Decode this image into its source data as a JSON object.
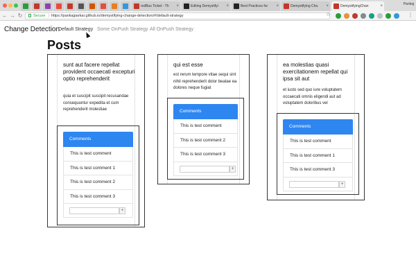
{
  "browser": {
    "tabs": [
      {
        "label": "",
        "favicon": "#2a9d3b"
      },
      {
        "label": "",
        "favicon": "#c0392b"
      },
      {
        "label": "",
        "favicon": "#8e44ad"
      },
      {
        "label": "",
        "favicon": "#e74c3c"
      },
      {
        "label": "",
        "favicon": "#c0392b"
      },
      {
        "label": "",
        "favicon": "#555555"
      },
      {
        "label": "",
        "favicon": "#d35400"
      },
      {
        "label": "",
        "favicon": "#e74c3c"
      },
      {
        "label": "",
        "favicon": "#e67e22"
      },
      {
        "label": "",
        "favicon": "#3498db"
      },
      {
        "label": "redBus Ticket - Th",
        "favicon": "#c0392b"
      },
      {
        "label": "Editing Demystifyi",
        "favicon": "#222222"
      },
      {
        "label": "Best Practices for",
        "favicon": "#222222"
      },
      {
        "label": "Demystifying Cha",
        "favicon": "#c0392b"
      },
      {
        "label": "DemystifyingChan",
        "favicon": "#c0392b"
      }
    ],
    "profile": "Pankaj",
    "secure_label": "Secure",
    "url": "https://pankajparkar.github.io/demystifying-change-detection/#/default-strategy"
  },
  "nav": {
    "brand": "Change Detection",
    "links": [
      "Default Strategy",
      "Some OnPush Strategy",
      "All OnPush Strategy"
    ]
  },
  "page_title": "Posts",
  "posts": [
    {
      "title": "sunt aut facere repellat provident occaecati excepturi optio reprehenderit",
      "body": "quia et suscipit suscipit recusandae consequuntur expedita et cum reprehenderit molestiae",
      "comments_header": "Comments",
      "comments": [
        "This is test comment",
        "This is test comment 1",
        "This is test comment 2",
        "This is test comment 3"
      ]
    },
    {
      "title": "qui est esse",
      "body": "est rerum tempore vitae sequi sint nihil reprehenderit dolor beatae ea dolores neque fugiat",
      "comments_header": "Comments",
      "comments": [
        "This is test comment",
        "This is test comment 2",
        "This is test comment 3"
      ]
    },
    {
      "title": "ea molestias quasi exercitationem repellat qui ipsa sit aut",
      "body": "et iusto sed quo iure voluptatem occaecati omnis eligendi aut ad voluptatem doloribus vel",
      "comments_header": "Comments",
      "comments": [
        "This is test comment",
        "This is test comment 1",
        "This is test comment 3"
      ]
    }
  ],
  "add_button_label": "+",
  "colors": {
    "accent": "#2e86f0"
  }
}
